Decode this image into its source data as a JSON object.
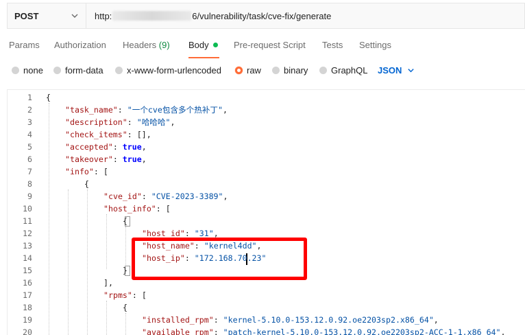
{
  "request": {
    "method": "POST",
    "url_prefix": "http:",
    "url_suffix": "6/vulnerability/task/cve-fix/generate"
  },
  "tabs": [
    {
      "label": "Params"
    },
    {
      "label": "Authorization"
    },
    {
      "label": "Headers",
      "count": "(9)"
    },
    {
      "label": "Body"
    },
    {
      "label": "Pre-request Script"
    },
    {
      "label": "Tests"
    },
    {
      "label": "Settings"
    }
  ],
  "body_types": {
    "options": [
      "none",
      "form-data",
      "x-www-form-urlencoded",
      "raw",
      "binary",
      "GraphQL"
    ],
    "selected": "raw",
    "format": "JSON"
  },
  "editor": {
    "lines": [
      {
        "n": "1",
        "text": "{"
      },
      {
        "n": "2",
        "key": "\"task_name\"",
        "val": "\"一个cve包含多个热补丁\"",
        "end": ","
      },
      {
        "n": "3",
        "key": "\"description\"",
        "val": "\"哈哈哈\"",
        "end": ","
      },
      {
        "n": "4",
        "key": "\"check_items\"",
        "plain": "[]",
        "end": ","
      },
      {
        "n": "5",
        "key": "\"accepted\"",
        "bool": "true",
        "end": ","
      },
      {
        "n": "6",
        "key": "\"takeover\"",
        "bool": "true",
        "end": ","
      },
      {
        "n": "7",
        "key": "\"info\"",
        "plain": "[",
        "end": ""
      },
      {
        "n": "8",
        "text": "{"
      },
      {
        "n": "9",
        "key": "\"cve_id\"",
        "val": "\"CVE-2023-3389\"",
        "end": ","
      },
      {
        "n": "10",
        "key": "\"host_info\"",
        "plain": "[",
        "end": ""
      },
      {
        "n": "11",
        "text": "{"
      },
      {
        "n": "12",
        "key": "\"host_id\"",
        "val": "\"31\"",
        "end": ","
      },
      {
        "n": "13",
        "key": "\"host_name\"",
        "val": "\"kernel4dd\"",
        "end": ","
      },
      {
        "n": "14",
        "key": "\"host_ip\"",
        "val": "\"172.168.70.23\"",
        "end": ""
      },
      {
        "n": "15",
        "text": "}"
      },
      {
        "n": "16",
        "text": "],"
      },
      {
        "n": "17",
        "key": "\"rpms\"",
        "plain": "[",
        "end": ""
      },
      {
        "n": "18",
        "text": "{"
      },
      {
        "n": "19",
        "key": "\"installed_rpm\"",
        "val": "\"kernel-5.10.0-153.12.0.92.oe2203sp2.x86_64\"",
        "end": ","
      },
      {
        "n": "20",
        "key": "\"available_rpm\"",
        "val": "\"patch-kernel-5.10.0-153.12.0.92.oe2203sp2-ACC-1-1.x86_64\"",
        "end": ","
      }
    ]
  },
  "colors": {
    "accent": "#ff6c37",
    "json_link": "#0265d2",
    "highlight": "#ff0000",
    "key": "#a31515",
    "string": "#0451a5",
    "boolean": "#0000ff"
  }
}
